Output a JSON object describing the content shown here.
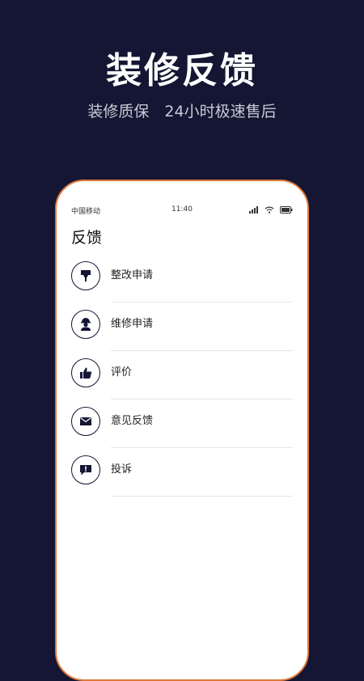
{
  "banner": {
    "title": "装修反馈",
    "subtitle": "装修质保　24小时极速售后"
  },
  "status_bar": {
    "carrier": "中国移动",
    "time": "11:40"
  },
  "page": {
    "title": "反馈"
  },
  "menu": [
    {
      "label": "整改申请",
      "icon": "rectification-icon"
    },
    {
      "label": "维修申请",
      "icon": "repair-worker-icon"
    },
    {
      "label": "评价",
      "icon": "thumbs-up-icon"
    },
    {
      "label": "意见反馈",
      "icon": "envelope-icon"
    },
    {
      "label": "投诉",
      "icon": "complaint-icon"
    }
  ],
  "colors": {
    "background": "#141633",
    "phone_border": "#e07a3c",
    "icon": "#141633"
  }
}
